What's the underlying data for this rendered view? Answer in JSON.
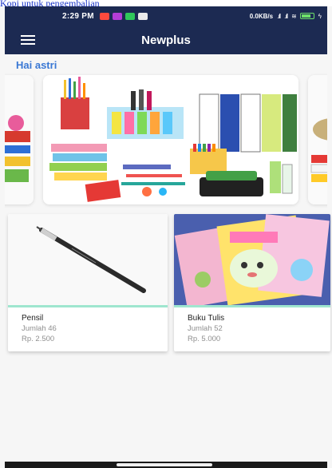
{
  "top_link": "Kopi untuk pengembalian",
  "status_bar": {
    "time": "2:29 PM",
    "net_speed": "0.0KB/s",
    "signal_1": ".ıll",
    "signal_2": ".ıll",
    "wifi": "≋",
    "bolt": "ϟ",
    "app_icon_colors": [
      "#ff4a3d",
      "#b33dd6",
      "#2fc85a",
      "#eaeaea"
    ]
  },
  "app_bar": {
    "title": "Newplus"
  },
  "greeting": "Hai astri",
  "products": [
    {
      "name": "Pensil",
      "quantity": "Jumlah 46",
      "price": "Rp. 2.500",
      "image": "pencil-image"
    },
    {
      "name": "Buku Tulis",
      "quantity": "Jumlah 52",
      "price": "Rp. 5.000",
      "image": "notebook-image"
    }
  ],
  "colors": {
    "app_bar": "#1c2a52",
    "greeting": "#3a78d4",
    "card_accent": "#9fe6cf"
  }
}
